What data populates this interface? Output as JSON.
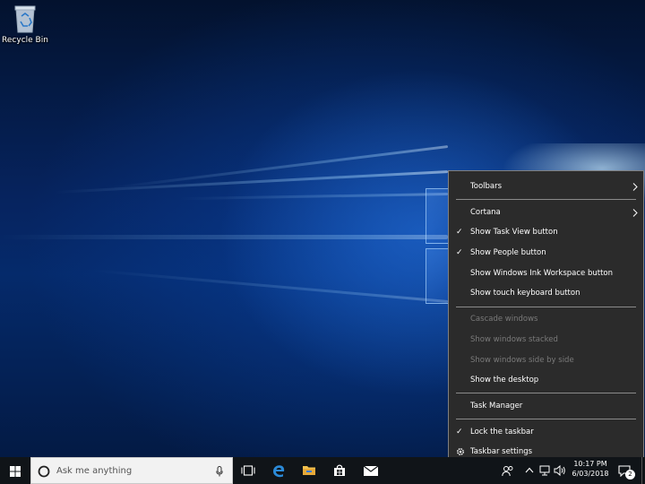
{
  "desktop": {
    "icons": [
      {
        "label": "Recycle Bin",
        "icon": "recycle-bin-icon"
      }
    ]
  },
  "context_menu": {
    "items": [
      {
        "label": "Toolbars",
        "checked": false,
        "enabled": true,
        "submenu": true
      },
      {
        "label": "Cortana",
        "checked": false,
        "enabled": true,
        "submenu": true
      },
      {
        "label": "Show Task View button",
        "checked": true,
        "enabled": true
      },
      {
        "label": "Show People button",
        "checked": true,
        "enabled": true
      },
      {
        "label": "Show Windows Ink Workspace button",
        "checked": false,
        "enabled": true
      },
      {
        "label": "Show touch keyboard button",
        "checked": false,
        "enabled": true
      },
      {
        "label": "Cascade windows",
        "checked": false,
        "enabled": false
      },
      {
        "label": "Show windows stacked",
        "checked": false,
        "enabled": false
      },
      {
        "label": "Show windows side by side",
        "checked": false,
        "enabled": false
      },
      {
        "label": "Show the desktop",
        "checked": false,
        "enabled": true
      },
      {
        "label": "Task Manager",
        "checked": false,
        "enabled": true
      },
      {
        "label": "Lock the taskbar",
        "checked": true,
        "enabled": true
      },
      {
        "label": "Taskbar settings",
        "checked": false,
        "enabled": true,
        "icon": "gear-icon"
      }
    ],
    "check_glyph": "✓"
  },
  "taskbar": {
    "search_placeholder": "Ask me anything",
    "pinned": [
      "task-view-icon",
      "edge-icon",
      "file-explorer-icon",
      "store-icon",
      "mail-icon"
    ],
    "tray": [
      "people-icon",
      "chevron-up-icon",
      "network-icon",
      "volume-icon",
      "keyboard-icon"
    ],
    "clock_time": "10:17 PM",
    "clock_date": "6/03/2018",
    "notification_count": "2"
  },
  "colors": {
    "menu_bg": "#2b2b2b",
    "menu_border": "#808080",
    "disabled_text": "#7a7a7a",
    "taskbar_bg": "#101418",
    "accent_blue": "#0078d7"
  }
}
